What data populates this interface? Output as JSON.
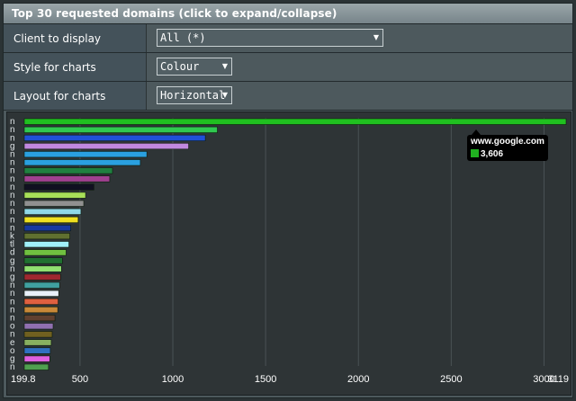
{
  "panel": {
    "title": "Top 30 requested domains (click to expand/collapse)"
  },
  "settings": {
    "client": {
      "label": "Client to display",
      "value": "All (*)"
    },
    "style": {
      "label": "Style for charts",
      "value": "Colour"
    },
    "layout": {
      "label": "Layout for charts",
      "value": "Horizontal"
    }
  },
  "tooltip": {
    "domain": "www.google.com",
    "value": "3,606",
    "color": "#20b020"
  },
  "chart_data": {
    "type": "bar",
    "orientation": "horizontal",
    "xlim": [
      199.8,
      3119
    ],
    "xticks": [
      "199.8",
      "500",
      "1000",
      "1500",
      "2000",
      "2500",
      "3000",
      "3119"
    ],
    "category_labels": [
      "n",
      "n",
      "n",
      "g",
      "n",
      "n",
      "n",
      "n",
      "n",
      "n",
      "n",
      "n",
      "n",
      "n",
      "k",
      "tl",
      "d",
      "g",
      "n",
      "g",
      "n",
      "n",
      "n",
      "n",
      "n",
      "o",
      "n",
      "e",
      "o",
      "g",
      "n"
    ],
    "values": [
      3119,
      1240,
      1175,
      1085,
      860,
      825,
      675,
      660,
      575,
      530,
      520,
      505,
      490,
      450,
      445,
      440,
      425,
      405,
      400,
      395,
      390,
      385,
      382,
      380,
      365,
      355,
      350,
      345,
      340,
      337,
      330
    ],
    "colors": [
      "#20c020",
      "#30c850",
      "#2050d8",
      "#c088e0",
      "#2aa0e0",
      "#2aa0e0",
      "#208040",
      "#a04090",
      "#101020",
      "#a8e058",
      "#909090",
      "#90d8e8",
      "#f0e020",
      "#1838a0",
      "#607030",
      "#a0f0f8",
      "#70c040",
      "#207030",
      "#90e070",
      "#a02830",
      "#40a0a0",
      "#e8f0f8",
      "#e06040",
      "#c88838",
      "#604030",
      "#9070b0",
      "#706020",
      "#88b060",
      "#3070c0",
      "#e060e0",
      "#50a050"
    ],
    "grid": true
  }
}
